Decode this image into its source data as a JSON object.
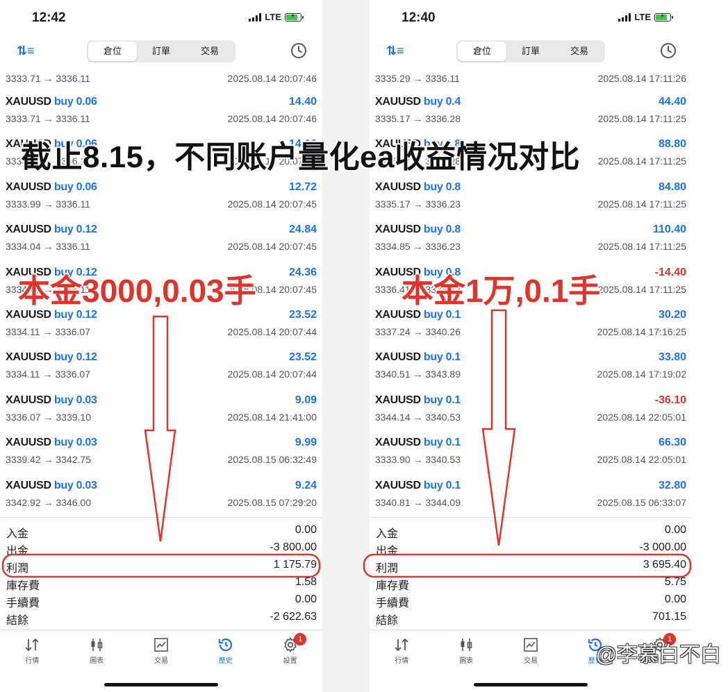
{
  "overlay": {
    "title": "截止8.15，不同账户量化ea收益情况对比",
    "left_label": "本金3000,0.03手",
    "right_label": "本金1万,0.1手",
    "watermark": "@李慕白不白"
  },
  "colors": {
    "accent": "#1a73e8",
    "negative": "#e0332a",
    "annotation": "#e0332a"
  },
  "segments": [
    "倉位",
    "訂單",
    "交易"
  ],
  "tabbar": [
    {
      "label": "行情",
      "icon": "up-down-arrows-icon"
    },
    {
      "label": "圖表",
      "icon": "candlestick-icon"
    },
    {
      "label": "交易",
      "icon": "chart-line-icon"
    },
    {
      "label": "歷史",
      "icon": "history-clock-icon"
    },
    {
      "label": "設置",
      "icon": "gear-icon",
      "badge": "1"
    }
  ],
  "left": {
    "time": "12:42",
    "network": "LTE",
    "partial": {
      "prices": "3333.71 → 3336.11",
      "date": "2025.08.14 20:07:46"
    },
    "trades": [
      {
        "symbol": "XAUUSD",
        "side": "buy 0.06",
        "profit": "14.40",
        "prices": "3333.71 → 3336.11",
        "date": "2025.08.14 20:07:46"
      },
      {
        "symbol": "XAUUSD",
        "side": "buy 0.06",
        "profit": "14.08",
        "prices": "3333.71 → 3336.11",
        "date": "2025.08.14 20:07:46"
      },
      {
        "symbol": "XAUUSD",
        "side": "buy 0.06",
        "profit": "12.72",
        "prices": "3333.99 → 3336.11",
        "date": "2025.08.14 20:07:45"
      },
      {
        "symbol": "XAUUSD",
        "side": "buy 0.12",
        "profit": "24.84",
        "prices": "3334.04 → 3336.11",
        "date": "2025.08.14 20:07:45"
      },
      {
        "symbol": "XAUUSD",
        "side": "buy 0.12",
        "profit": "24.36",
        "prices": "3334.08 → 3336.11",
        "date": "2025.08.14 20:07:45"
      },
      {
        "symbol": "XAUUSD",
        "side": "buy 0.12",
        "profit": "23.52",
        "prices": "3334.11 → 3336.07",
        "date": "2025.08.14 20:07:44"
      },
      {
        "symbol": "XAUUSD",
        "side": "buy 0.12",
        "profit": "23.52",
        "prices": "3334.11 → 3336.07",
        "date": "2025.08.14 20:07:44"
      },
      {
        "symbol": "XAUUSD",
        "side": "buy 0.03",
        "profit": "9.09",
        "prices": "3336.07 → 3339.10",
        "date": "2025.08.14 21:41:00"
      },
      {
        "symbol": "XAUUSD",
        "side": "buy 0.03",
        "profit": "9.99",
        "prices": "3339.42 → 3342.75",
        "date": "2025.08.15 06:32:49"
      },
      {
        "symbol": "XAUUSD",
        "side": "buy 0.03",
        "profit": "9.24",
        "prices": "3342.92 → 3346.00",
        "date": "2025.08.15 07:29:20"
      }
    ],
    "summary": [
      {
        "label": "入金",
        "value": "0.00"
      },
      {
        "label": "出金",
        "value": "-3 800.00"
      },
      {
        "label": "利潤",
        "value": "1 175.79"
      },
      {
        "label": "庫存費",
        "value": "1.58"
      },
      {
        "label": "手續費",
        "value": "0.00"
      },
      {
        "label": "結餘",
        "value": "-2 622.63"
      }
    ]
  },
  "right": {
    "time": "12:40",
    "network": "LTE",
    "partial": {
      "prices": "3335.29 → 3336.11",
      "date": "2025.08.14 17:11:26"
    },
    "trades": [
      {
        "symbol": "XAUUSD",
        "side": "buy 0.4",
        "profit": "44.40",
        "prices": "3335.17 → 3336.28",
        "date": "2025.08.14 17:11:25"
      },
      {
        "symbol": "XAUUSD",
        "side": "buy 0.8",
        "profit": "88.80",
        "prices": "3335.17 → 3336.28",
        "date": "2025.08.14 17:11:25"
      },
      {
        "symbol": "XAUUSD",
        "side": "buy 0.8",
        "profit": "84.80",
        "prices": "3335.17 → 3336.23",
        "date": "2025.08.14 17:11:25"
      },
      {
        "symbol": "XAUUSD",
        "side": "buy 0.8",
        "profit": "110.40",
        "prices": "3334.85 → 3336.23",
        "date": "2025.08.14 17:11:25"
      },
      {
        "symbol": "XAUUSD",
        "side": "buy 0.8",
        "profit": "-14.40",
        "prices": "3336.41 → 3336.23",
        "date": "2025.08.14 17:11:25"
      },
      {
        "symbol": "XAUUSD",
        "side": "buy 0.1",
        "profit": "30.20",
        "prices": "3337.24 → 3340.26",
        "date": "2025.08.14 17:16:25"
      },
      {
        "symbol": "XAUUSD",
        "side": "buy 0.1",
        "profit": "33.80",
        "prices": "3340.51 → 3343.89",
        "date": "2025.08.14 17:19:02"
      },
      {
        "symbol": "XAUUSD",
        "side": "buy 0.1",
        "profit": "-36.10",
        "prices": "3344.14 → 3340.53",
        "date": "2025.08.14 22:05:01"
      },
      {
        "symbol": "XAUUSD",
        "side": "buy 0.1",
        "profit": "66.30",
        "prices": "3333.90 → 3340.53",
        "date": "2025.08.14 22:05:01"
      },
      {
        "symbol": "XAUUSD",
        "side": "buy 0.1",
        "profit": "32.80",
        "prices": "3340.81 → 3344.09",
        "date": "2025.08.15 06:33:07"
      }
    ],
    "summary": [
      {
        "label": "入金",
        "value": "0.00"
      },
      {
        "label": "出金",
        "value": "-3 000.00"
      },
      {
        "label": "利潤",
        "value": "3 695.40"
      },
      {
        "label": "庫存費",
        "value": "5.75"
      },
      {
        "label": "手續費",
        "value": "0.00"
      },
      {
        "label": "結餘",
        "value": "701.15"
      }
    ]
  }
}
